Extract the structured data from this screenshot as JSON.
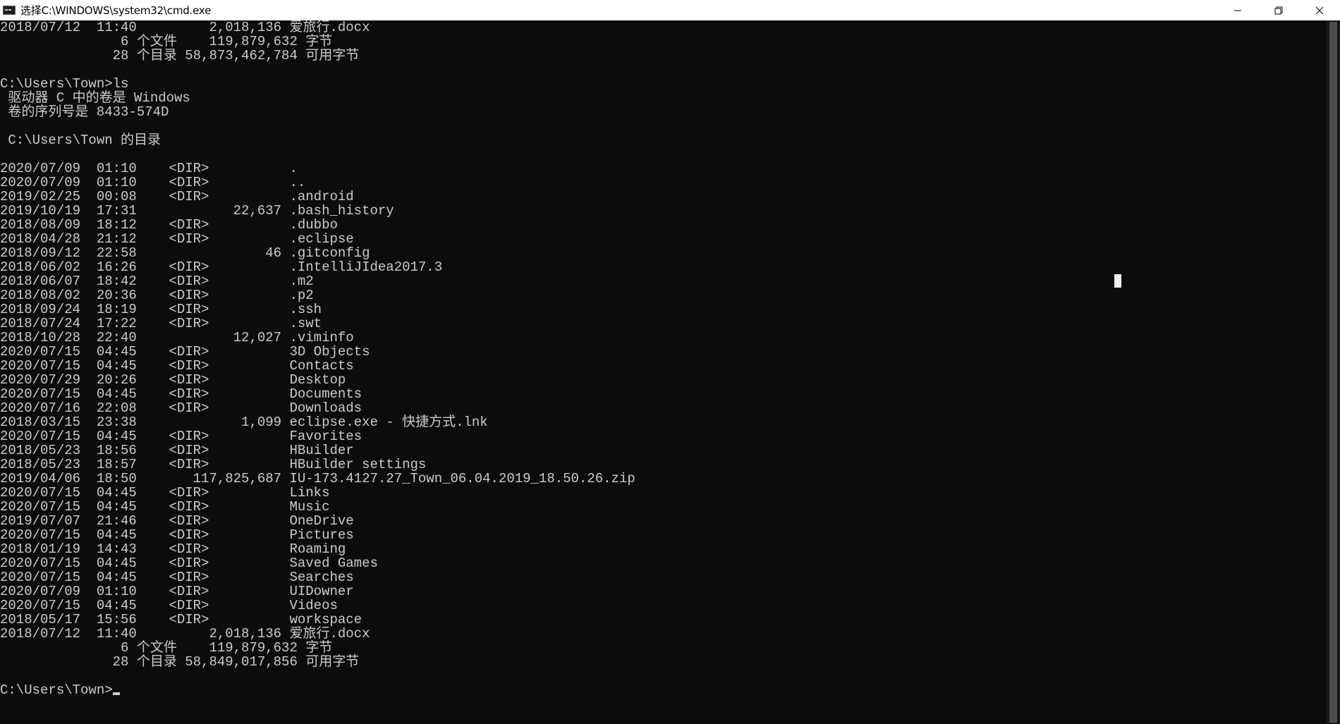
{
  "window": {
    "title": "选择C:\\WINDOWS\\system32\\cmd.exe",
    "icon": "cmd-app-icon",
    "controls": {
      "minimize_icon": "minimize-icon",
      "restore_icon": "restore-icon",
      "close_icon": "close-icon"
    }
  },
  "colors": {
    "console_background": "#0c0c0c",
    "console_text": "#cccccc",
    "titlebar_background": "#ffffff"
  },
  "console": {
    "lines": [
      "2018/07/12  11:40         2,018,136 爱旅行.docx",
      "               6 个文件    119,879,632 字节",
      "              28 个目录 58,873,462,784 可用字节",
      "",
      "C:\\Users\\Town>ls",
      " 驱动器 C 中的卷是 Windows",
      " 卷的序列号是 8433-574D",
      "",
      " C:\\Users\\Town 的目录",
      "",
      "2020/07/09  01:10    <DIR>          .",
      "2020/07/09  01:10    <DIR>          ..",
      "2019/02/25  00:08    <DIR>          .android",
      "2019/10/19  17:31            22,637 .bash_history",
      "2018/08/09  18:12    <DIR>          .dubbo",
      "2018/04/28  21:12    <DIR>          .eclipse",
      "2018/09/12  22:58                46 .gitconfig",
      "2018/06/02  16:26    <DIR>          .IntelliJIdea2017.3",
      "2018/06/07  18:42    <DIR>          .m2",
      "2018/08/02  20:36    <DIR>          .p2",
      "2018/09/24  18:19    <DIR>          .ssh",
      "2018/07/24  17:22    <DIR>          .swt",
      "2018/10/28  22:40            12,027 .viminfo",
      "2020/07/15  04:45    <DIR>          3D Objects",
      "2020/07/15  04:45    <DIR>          Contacts",
      "2020/07/29  20:26    <DIR>          Desktop",
      "2020/07/15  04:45    <DIR>          Documents",
      "2020/07/16  22:08    <DIR>          Downloads",
      "2018/03/15  23:38             1,099 eclipse.exe - 快捷方式.lnk",
      "2020/07/15  04:45    <DIR>          Favorites",
      "2018/05/23  18:56    <DIR>          HBuilder",
      "2018/05/23  18:57    <DIR>          HBuilder settings",
      "2019/04/06  18:50       117,825,687 IU-173.4127.27_Town_06.04.2019_18.50.26.zip",
      "2020/07/15  04:45    <DIR>          Links",
      "2020/07/15  04:45    <DIR>          Music",
      "2019/07/07  21:46    <DIR>          OneDrive",
      "2020/07/15  04:45    <DIR>          Pictures",
      "2018/01/19  14:43    <DIR>          Roaming",
      "2020/07/15  04:45    <DIR>          Saved Games",
      "2020/07/15  04:45    <DIR>          Searches",
      "2020/07/09  01:10    <DIR>          UIDowner",
      "2020/07/15  04:45    <DIR>          Videos",
      "2018/05/17  15:56    <DIR>          workspace",
      "2018/07/12  11:40         2,018,136 爱旅行.docx",
      "               6 个文件    119,879,632 字节",
      "              28 个目录 58,849,017,856 可用字节",
      "",
      "C:\\Users\\Town>"
    ]
  }
}
